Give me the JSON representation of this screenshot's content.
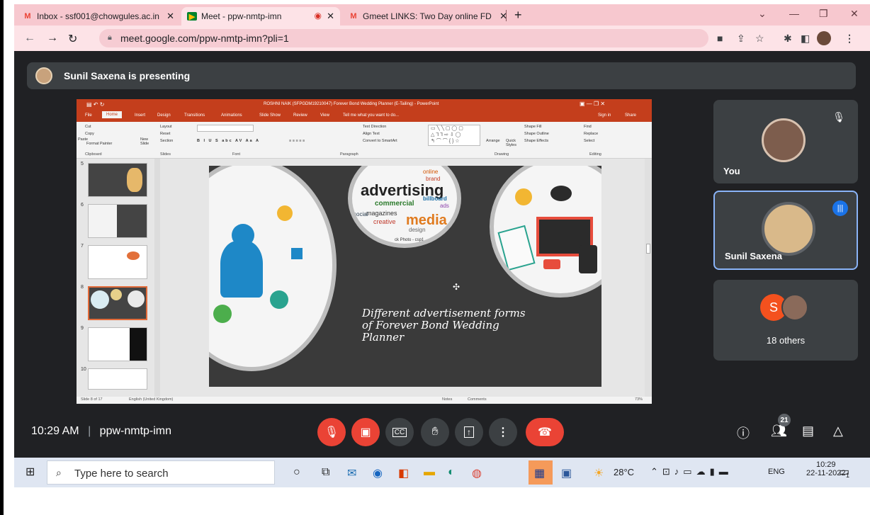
{
  "browser": {
    "tabs": [
      {
        "label": "Inbox - ssf001@chowgules.ac.in",
        "icon": "gmail-icon"
      },
      {
        "label": "Meet - ppw-nmtp-imn",
        "icon": "meet-icon"
      },
      {
        "label": "Gmeet LINKS: Two Day online FD",
        "icon": "gmail-icon"
      }
    ],
    "new_tab": "+",
    "url": "meet.google.com/ppw-nmtp-imn?pli=1"
  },
  "meet": {
    "presenting_text": "Sunil Saxena is presenting",
    "tiles": {
      "you": "You",
      "sunil": "Sunil Saxena",
      "others_initial": "S",
      "others": "18 others"
    },
    "clock": "10:29 AM",
    "separator": "|",
    "meeting_code": "ppw-nmtp-imn",
    "participants_count": "21",
    "colors": {
      "background": "#202124",
      "tile": "#3c4043",
      "danger": "#ea4335",
      "accent": "#8ab4f8"
    }
  },
  "ppt": {
    "window_title": "ROSHNI NAIK (SFPGDM19210047) Forever Bond Wedding Planner (E-Tailing) - PowerPoint",
    "tabs": [
      "File",
      "Home",
      "Insert",
      "Design",
      "Transitions",
      "Animations",
      "Slide Show",
      "Review",
      "View"
    ],
    "tell_me": "Tell me what you want to do...",
    "sign_in": "Sign in",
    "share": "Share",
    "ribbon": {
      "cut": "Cut",
      "copy": "Copy",
      "paste": "Paste",
      "format_painter": "Format Painter",
      "new_slide": "New Slide",
      "layout": "Layout",
      "reset": "Reset",
      "section": "Section",
      "text_direction": "Text Direction",
      "align_text": "Align Text",
      "convert": "Convert to SmartArt",
      "arrange": "Arrange",
      "quick_styles": "Quick Styles",
      "shape_fill": "Shape Fill",
      "shape_outline": "Shape Outline",
      "shape_effects": "Shape Effects",
      "find": "Find",
      "replace": "Replace",
      "select": "Select",
      "groups": [
        "Clipboard",
        "Slides",
        "Font",
        "Paragraph",
        "Drawing",
        "Editing"
      ]
    },
    "slide_numbers": [
      "5",
      "6",
      "7",
      "8",
      "9",
      "10"
    ],
    "slide_title": "Different advertisement forms of Forever Bond Wedding Planner",
    "collage_words": [
      "advertising",
      "media",
      "brand",
      "billboard",
      "commercial",
      "magazines",
      "creative",
      "design",
      "online",
      "social",
      "ads"
    ],
    "photo_caption": "ck Photo - csp1",
    "status_slide": "Slide 8 of 17",
    "status_lang": "English (United Kingdom)",
    "notes": "Notes",
    "comments": "Comments",
    "zoom": "73%"
  },
  "taskbar": {
    "search_placeholder": "Type here to search",
    "weather": "28°C",
    "lang": "ENG",
    "time": "10:29",
    "date": "22-11-2022",
    "notif": "1"
  }
}
